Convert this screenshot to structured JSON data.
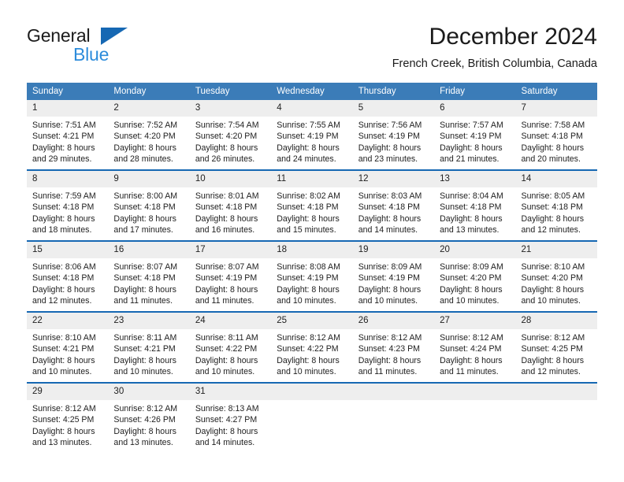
{
  "brand": {
    "name_top": "General",
    "name_bottom": "Blue",
    "color_dark": "#1b1b1b",
    "color_blue": "#2d8cdb",
    "triangle_color": "#1668b3"
  },
  "header": {
    "title": "December 2024",
    "subtitle": "French Creek, British Columbia, Canada"
  },
  "theme": {
    "header_row_bg": "#3b7cb8",
    "header_row_text": "#ffffff",
    "row_divider": "#1668b3",
    "daynum_bg": "#eeeeee",
    "text": "#1e1e1e"
  },
  "weekday_headers": [
    "Sunday",
    "Monday",
    "Tuesday",
    "Wednesday",
    "Thursday",
    "Friday",
    "Saturday"
  ],
  "weeks": [
    [
      {
        "day": "1",
        "lines": [
          "Sunrise: 7:51 AM",
          "Sunset: 4:21 PM",
          "Daylight: 8 hours",
          "and 29 minutes."
        ]
      },
      {
        "day": "2",
        "lines": [
          "Sunrise: 7:52 AM",
          "Sunset: 4:20 PM",
          "Daylight: 8 hours",
          "and 28 minutes."
        ]
      },
      {
        "day": "3",
        "lines": [
          "Sunrise: 7:54 AM",
          "Sunset: 4:20 PM",
          "Daylight: 8 hours",
          "and 26 minutes."
        ]
      },
      {
        "day": "4",
        "lines": [
          "Sunrise: 7:55 AM",
          "Sunset: 4:19 PM",
          "Daylight: 8 hours",
          "and 24 minutes."
        ]
      },
      {
        "day": "5",
        "lines": [
          "Sunrise: 7:56 AM",
          "Sunset: 4:19 PM",
          "Daylight: 8 hours",
          "and 23 minutes."
        ]
      },
      {
        "day": "6",
        "lines": [
          "Sunrise: 7:57 AM",
          "Sunset: 4:19 PM",
          "Daylight: 8 hours",
          "and 21 minutes."
        ]
      },
      {
        "day": "7",
        "lines": [
          "Sunrise: 7:58 AM",
          "Sunset: 4:18 PM",
          "Daylight: 8 hours",
          "and 20 minutes."
        ]
      }
    ],
    [
      {
        "day": "8",
        "lines": [
          "Sunrise: 7:59 AM",
          "Sunset: 4:18 PM",
          "Daylight: 8 hours",
          "and 18 minutes."
        ]
      },
      {
        "day": "9",
        "lines": [
          "Sunrise: 8:00 AM",
          "Sunset: 4:18 PM",
          "Daylight: 8 hours",
          "and 17 minutes."
        ]
      },
      {
        "day": "10",
        "lines": [
          "Sunrise: 8:01 AM",
          "Sunset: 4:18 PM",
          "Daylight: 8 hours",
          "and 16 minutes."
        ]
      },
      {
        "day": "11",
        "lines": [
          "Sunrise: 8:02 AM",
          "Sunset: 4:18 PM",
          "Daylight: 8 hours",
          "and 15 minutes."
        ]
      },
      {
        "day": "12",
        "lines": [
          "Sunrise: 8:03 AM",
          "Sunset: 4:18 PM",
          "Daylight: 8 hours",
          "and 14 minutes."
        ]
      },
      {
        "day": "13",
        "lines": [
          "Sunrise: 8:04 AM",
          "Sunset: 4:18 PM",
          "Daylight: 8 hours",
          "and 13 minutes."
        ]
      },
      {
        "day": "14",
        "lines": [
          "Sunrise: 8:05 AM",
          "Sunset: 4:18 PM",
          "Daylight: 8 hours",
          "and 12 minutes."
        ]
      }
    ],
    [
      {
        "day": "15",
        "lines": [
          "Sunrise: 8:06 AM",
          "Sunset: 4:18 PM",
          "Daylight: 8 hours",
          "and 12 minutes."
        ]
      },
      {
        "day": "16",
        "lines": [
          "Sunrise: 8:07 AM",
          "Sunset: 4:18 PM",
          "Daylight: 8 hours",
          "and 11 minutes."
        ]
      },
      {
        "day": "17",
        "lines": [
          "Sunrise: 8:07 AM",
          "Sunset: 4:19 PM",
          "Daylight: 8 hours",
          "and 11 minutes."
        ]
      },
      {
        "day": "18",
        "lines": [
          "Sunrise: 8:08 AM",
          "Sunset: 4:19 PM",
          "Daylight: 8 hours",
          "and 10 minutes."
        ]
      },
      {
        "day": "19",
        "lines": [
          "Sunrise: 8:09 AM",
          "Sunset: 4:19 PM",
          "Daylight: 8 hours",
          "and 10 minutes."
        ]
      },
      {
        "day": "20",
        "lines": [
          "Sunrise: 8:09 AM",
          "Sunset: 4:20 PM",
          "Daylight: 8 hours",
          "and 10 minutes."
        ]
      },
      {
        "day": "21",
        "lines": [
          "Sunrise: 8:10 AM",
          "Sunset: 4:20 PM",
          "Daylight: 8 hours",
          "and 10 minutes."
        ]
      }
    ],
    [
      {
        "day": "22",
        "lines": [
          "Sunrise: 8:10 AM",
          "Sunset: 4:21 PM",
          "Daylight: 8 hours",
          "and 10 minutes."
        ]
      },
      {
        "day": "23",
        "lines": [
          "Sunrise: 8:11 AM",
          "Sunset: 4:21 PM",
          "Daylight: 8 hours",
          "and 10 minutes."
        ]
      },
      {
        "day": "24",
        "lines": [
          "Sunrise: 8:11 AM",
          "Sunset: 4:22 PM",
          "Daylight: 8 hours",
          "and 10 minutes."
        ]
      },
      {
        "day": "25",
        "lines": [
          "Sunrise: 8:12 AM",
          "Sunset: 4:22 PM",
          "Daylight: 8 hours",
          "and 10 minutes."
        ]
      },
      {
        "day": "26",
        "lines": [
          "Sunrise: 8:12 AM",
          "Sunset: 4:23 PM",
          "Daylight: 8 hours",
          "and 11 minutes."
        ]
      },
      {
        "day": "27",
        "lines": [
          "Sunrise: 8:12 AM",
          "Sunset: 4:24 PM",
          "Daylight: 8 hours",
          "and 11 minutes."
        ]
      },
      {
        "day": "28",
        "lines": [
          "Sunrise: 8:12 AM",
          "Sunset: 4:25 PM",
          "Daylight: 8 hours",
          "and 12 minutes."
        ]
      }
    ],
    [
      {
        "day": "29",
        "lines": [
          "Sunrise: 8:12 AM",
          "Sunset: 4:25 PM",
          "Daylight: 8 hours",
          "and 13 minutes."
        ]
      },
      {
        "day": "30",
        "lines": [
          "Sunrise: 8:12 AM",
          "Sunset: 4:26 PM",
          "Daylight: 8 hours",
          "and 13 minutes."
        ]
      },
      {
        "day": "31",
        "lines": [
          "Sunrise: 8:13 AM",
          "Sunset: 4:27 PM",
          "Daylight: 8 hours",
          "and 14 minutes."
        ]
      },
      {
        "day": "",
        "lines": []
      },
      {
        "day": "",
        "lines": []
      },
      {
        "day": "",
        "lines": []
      },
      {
        "day": "",
        "lines": []
      }
    ]
  ]
}
